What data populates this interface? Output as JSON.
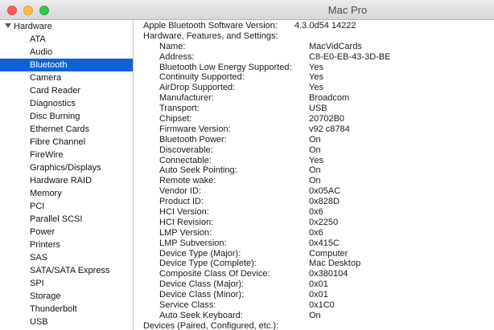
{
  "window": {
    "title": "Mac Pro"
  },
  "sidebar": {
    "group_label": "Hardware",
    "items": [
      {
        "label": "ATA"
      },
      {
        "label": "Audio"
      },
      {
        "label": "Bluetooth",
        "selected": true
      },
      {
        "label": "Camera"
      },
      {
        "label": "Card Reader"
      },
      {
        "label": "Diagnostics"
      },
      {
        "label": "Disc Burning"
      },
      {
        "label": "Ethernet Cards"
      },
      {
        "label": "Fibre Channel"
      },
      {
        "label": "FireWire"
      },
      {
        "label": "Graphics/Displays"
      },
      {
        "label": "Hardware RAID"
      },
      {
        "label": "Memory"
      },
      {
        "label": "PCI"
      },
      {
        "label": "Parallel SCSI"
      },
      {
        "label": "Power"
      },
      {
        "label": "Printers"
      },
      {
        "label": "SAS"
      },
      {
        "label": "SATA/SATA Express"
      },
      {
        "label": "SPI"
      },
      {
        "label": "Storage"
      },
      {
        "label": "Thunderbolt"
      },
      {
        "label": "USB"
      }
    ]
  },
  "content": {
    "version_label": "Apple Bluetooth Software Version:",
    "version_value": "4.3.0d54 14222",
    "section_label": "Hardware, Features, and Settings:",
    "rows": [
      {
        "key": "Name:",
        "value": "MacVidCards"
      },
      {
        "key": "Address:",
        "value": "C8-E0-EB-43-3D-BE"
      },
      {
        "key": "Bluetooth Low Energy Supported:",
        "value": "Yes"
      },
      {
        "key": "Continuity Supported:",
        "value": "Yes"
      },
      {
        "key": "AirDrop Supported:",
        "value": "Yes"
      },
      {
        "key": "Manufacturer:",
        "value": "Broadcom"
      },
      {
        "key": "Transport:",
        "value": "USB"
      },
      {
        "key": "Chipset:",
        "value": "20702B0"
      },
      {
        "key": "Firmware Version:",
        "value": "v92 c8784"
      },
      {
        "key": "Bluetooth Power:",
        "value": "On"
      },
      {
        "key": "Discoverable:",
        "value": "On"
      },
      {
        "key": "Connectable:",
        "value": "Yes"
      },
      {
        "key": "Auto Seek Pointing:",
        "value": "On"
      },
      {
        "key": "Remote wake:",
        "value": "On"
      },
      {
        "key": "Vendor ID:",
        "value": "0x05AC"
      },
      {
        "key": "Product ID:",
        "value": "0x828D"
      },
      {
        "key": "HCI Version:",
        "value": "0x6"
      },
      {
        "key": "HCI Revision:",
        "value": "0x2250"
      },
      {
        "key": "LMP Version:",
        "value": "0x6"
      },
      {
        "key": "LMP Subversion:",
        "value": "0x415C"
      },
      {
        "key": "Device Type (Major):",
        "value": "Computer"
      },
      {
        "key": "Device Type (Complete):",
        "value": "Mac Desktop"
      },
      {
        "key": "Composite Class Of Device:",
        "value": "0x380104"
      },
      {
        "key": "Device Class (Major):",
        "value": "0x01"
      },
      {
        "key": "Device Class (Minor):",
        "value": "0x01"
      },
      {
        "key": "Service Class:",
        "value": "0x1C0"
      },
      {
        "key": "Auto Seek Keyboard:",
        "value": "On"
      }
    ],
    "next_section_partial": "Devices (Paired, Configured, etc.):"
  },
  "colors": {
    "selection": "#0f63d6",
    "close": "#fc605c",
    "minimize": "#fdbc40",
    "zoom": "#34c84a"
  }
}
